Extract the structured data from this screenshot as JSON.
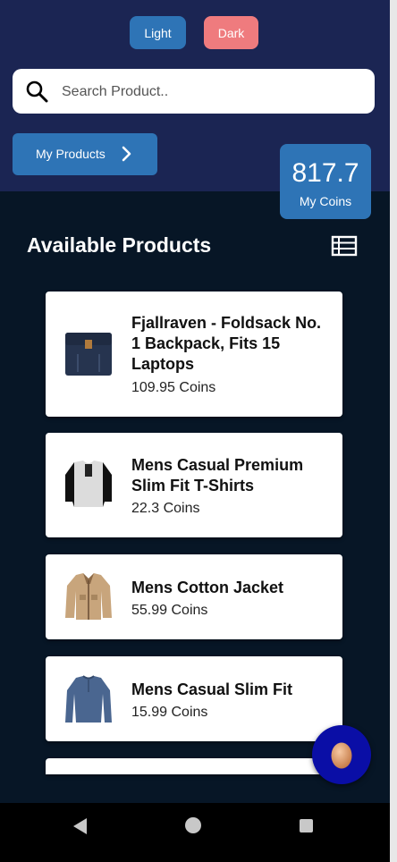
{
  "theme": {
    "light_label": "Light",
    "dark_label": "Dark",
    "accent": "#2e74b6",
    "danger": "#ef7b7e"
  },
  "search": {
    "placeholder": "Search Product.."
  },
  "nav": {
    "my_products_label": "My Products"
  },
  "wallet": {
    "coins_value": "817.7",
    "coins_label": "My Coins"
  },
  "section": {
    "title": "Available Products"
  },
  "products": [
    {
      "title": "Fjallraven - Foldsack No. 1 Backpack, Fits 15 Laptops",
      "price": "109.95 Coins",
      "image": "backpack"
    },
    {
      "title": "Mens Casual Premium Slim Fit T-Shirts",
      "price": "22.3 Coins",
      "image": "tshirt"
    },
    {
      "title": "Mens Cotton Jacket",
      "price": "55.99 Coins",
      "image": "jacket"
    },
    {
      "title": "Mens Casual Slim Fit",
      "price": "15.99 Coins",
      "image": "longsleeve"
    }
  ],
  "icons": {
    "search": "search-icon",
    "chevron": "chevron-right-icon",
    "list": "list-icon",
    "fab": "egg-icon",
    "system_nav": [
      "back-icon",
      "home-icon",
      "recent-apps-icon"
    ]
  }
}
